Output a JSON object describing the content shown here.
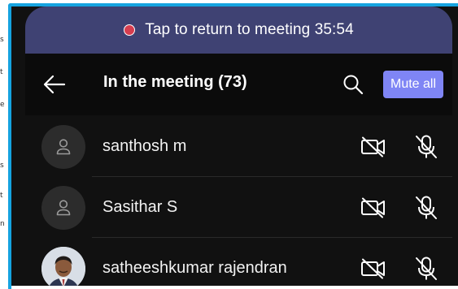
{
  "edge_chars": [
    "s",
    "t",
    "e",
    "s",
    "t",
    "n"
  ],
  "banner": {
    "text": "Tap to return to meeting 35:54"
  },
  "appbar": {
    "title": "In the meeting (73)",
    "mute_all_label": "Mute all"
  },
  "participants": [
    {
      "name": "santhosh m",
      "avatar": "person-icon",
      "camera": "camera-off",
      "mic": "mic-off"
    },
    {
      "name": "Sasithar S",
      "avatar": "person-icon",
      "camera": "camera-off",
      "mic": "mic-off"
    },
    {
      "name": "satheeshkumar rajendran",
      "avatar": "profile-photo",
      "camera": "camera-off",
      "mic": "mic-off"
    }
  ],
  "colors": {
    "frame": "#15a3e0",
    "banner": "#3f4273",
    "record_dot": "#d73d4f",
    "accent_button": "#7f85f5",
    "background": "#111111"
  }
}
